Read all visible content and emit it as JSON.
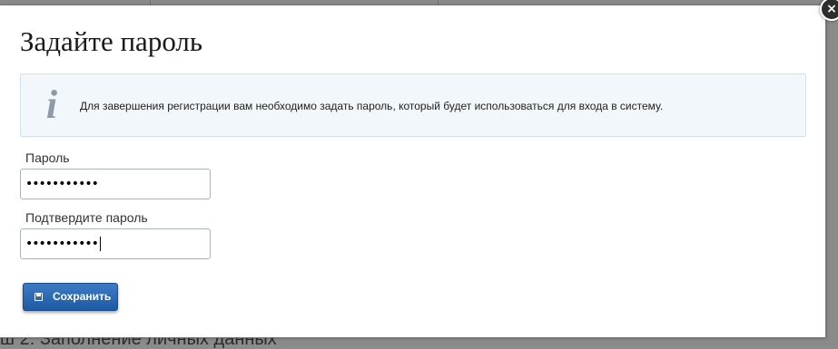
{
  "background": {
    "partial_text": "ш 2. Заполнение личных данных"
  },
  "dialog": {
    "title": "Задайте пароль",
    "close_symbol": "×",
    "info": {
      "icon": "info-icon",
      "icon_glyph": "i",
      "text": "Для завершения регистрации вам необходимо задать пароль, который будет использоваться для входа в систему."
    },
    "password": {
      "label": "Пароль",
      "value": "•••••••••••"
    },
    "confirm_password": {
      "label": "Подтвердите пароль",
      "value": "•••••••••••"
    },
    "save_button": {
      "label": "Сохранить",
      "icon": "save-icon"
    }
  },
  "colors": {
    "button": "#2a68b3",
    "info_background": "#f2f7fb",
    "info_border": "#cfe3ef",
    "overlay": "#8a8a8a"
  }
}
